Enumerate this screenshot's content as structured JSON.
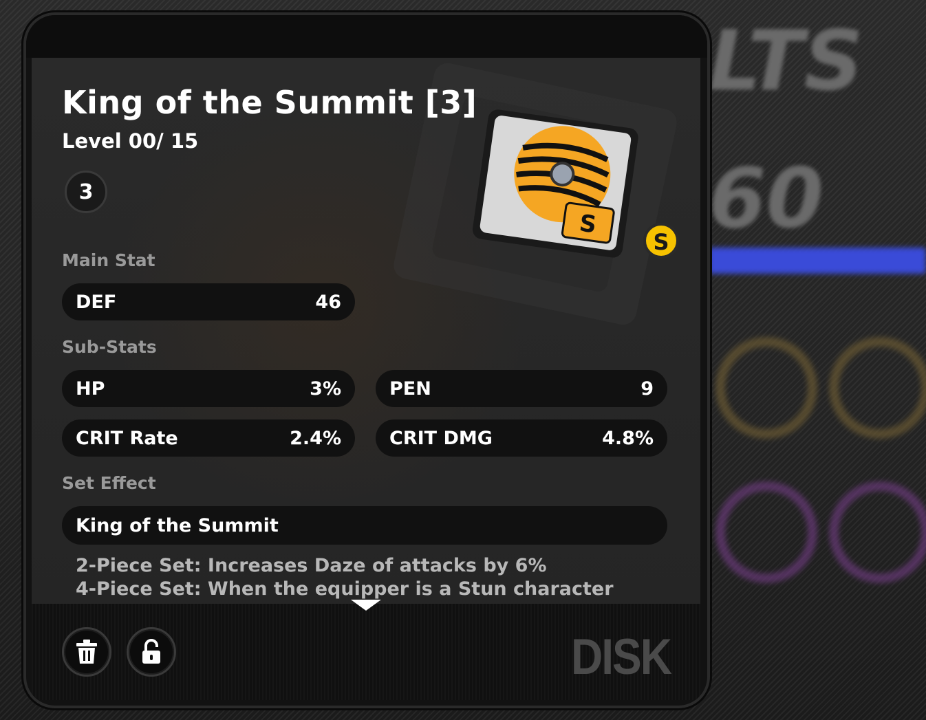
{
  "disk": {
    "name": "King of the Summit [3]",
    "level_label": "Level",
    "level_current": "00",
    "level_separator": "/",
    "level_max": "15",
    "slot": "3",
    "rarity": "S"
  },
  "main_stat": {
    "label": "Main Stat",
    "name": "DEF",
    "value": "46"
  },
  "sub_stats": {
    "label": "Sub-Stats",
    "items": [
      {
        "name": "HP",
        "value": "3%"
      },
      {
        "name": "PEN",
        "value": "9"
      },
      {
        "name": "CRIT Rate",
        "value": "2.4%"
      },
      {
        "name": "CRIT DMG",
        "value": "4.8%"
      }
    ]
  },
  "set_effect": {
    "label": "Set Effect",
    "name": "King of the Summit",
    "two_piece": "2-Piece Set: Increases Daze of attacks by 6%",
    "four_piece": "4-Piece Set: When the equipper is a Stun character"
  },
  "footer": {
    "category": "DISK",
    "trash_icon": "trash-icon",
    "lock_icon": "unlock-icon"
  },
  "background": {
    "number": "60",
    "title_fragment": "LTS"
  },
  "colors": {
    "accent_orange": "#f5a623",
    "rarity_gold": "#f7c200",
    "panel_dark": "#121212"
  }
}
